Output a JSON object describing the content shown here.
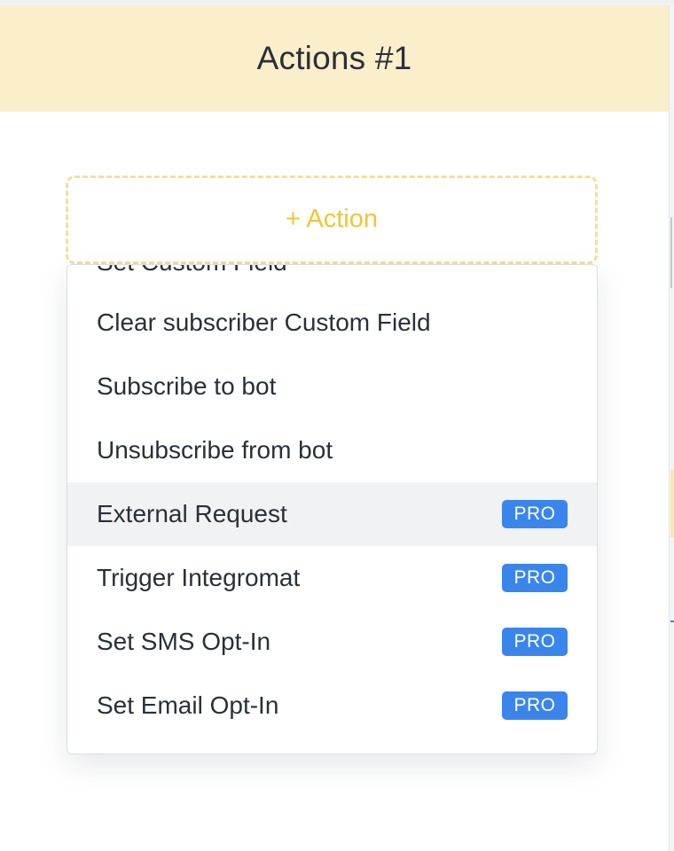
{
  "header": {
    "title": "Actions #1"
  },
  "add_action": {
    "label": "+ Action"
  },
  "menu": {
    "items": [
      {
        "label": "Set Custom Field",
        "badge": ""
      },
      {
        "label": "Clear subscriber Custom Field",
        "badge": ""
      },
      {
        "label": "Subscribe to bot",
        "badge": ""
      },
      {
        "label": "Unsubscribe from bot",
        "badge": ""
      },
      {
        "label": "External Request",
        "badge": "PRO"
      },
      {
        "label": "Trigger Integromat",
        "badge": "PRO"
      },
      {
        "label": "Set SMS Opt-In",
        "badge": "PRO"
      },
      {
        "label": "Set Email Opt-In",
        "badge": "PRO"
      }
    ],
    "highlighted_item": "External Request"
  },
  "colors": {
    "header_bg": "#fbeecb",
    "accent_yellow": "#f2c437",
    "dashed_border": "#f7dd95",
    "pro_badge": "#3a85ec",
    "hover_bg": "#f1f2f4",
    "text": "#2b2f38"
  }
}
